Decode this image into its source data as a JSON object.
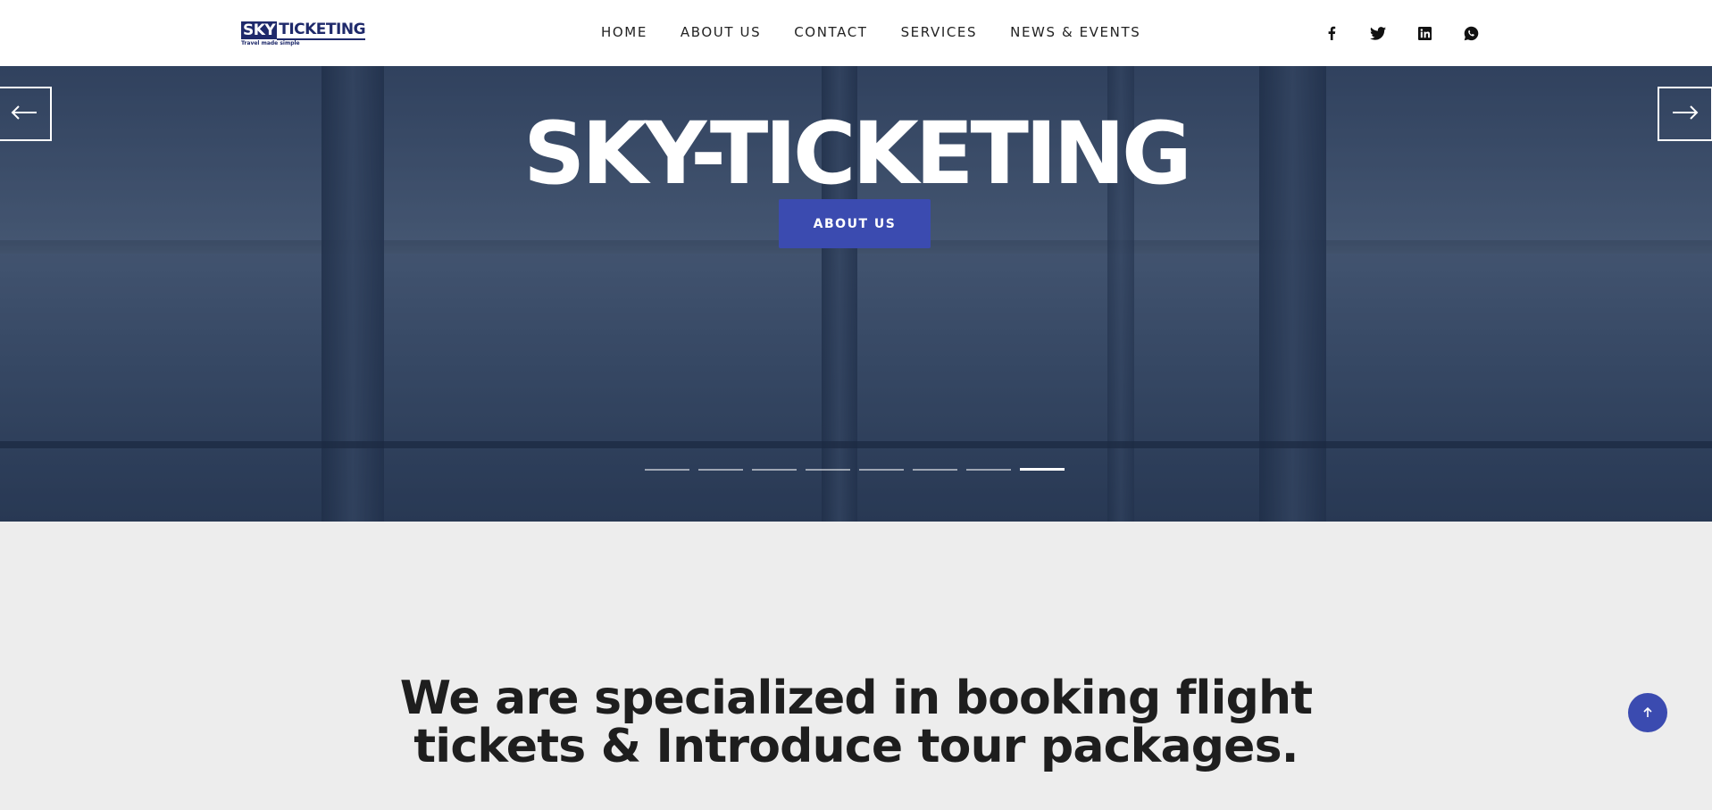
{
  "header": {
    "logo": {
      "part1": "SKY",
      "part2": "TICKETING",
      "tagline": "Travel made simple"
    },
    "nav": [
      {
        "label": "HOME"
      },
      {
        "label": "ABOUT US"
      },
      {
        "label": "CONTACT"
      },
      {
        "label": "SERVICES"
      },
      {
        "label": "NEWS & EVENTS"
      }
    ],
    "social_icons": [
      "facebook-icon",
      "twitter-icon",
      "linkedin-icon",
      "whatsapp-icon"
    ]
  },
  "hero": {
    "title": "SKY-TICKETING",
    "button_label": "ABOUT US",
    "slide_count": 8,
    "active_slide": 8,
    "accent_color": "#3b4bb0"
  },
  "intro": {
    "line1": "We are specialized in booking flight",
    "line2": "tickets & Introduce tour packages."
  },
  "back_to_top": {
    "icon": "arrow-up-icon"
  }
}
